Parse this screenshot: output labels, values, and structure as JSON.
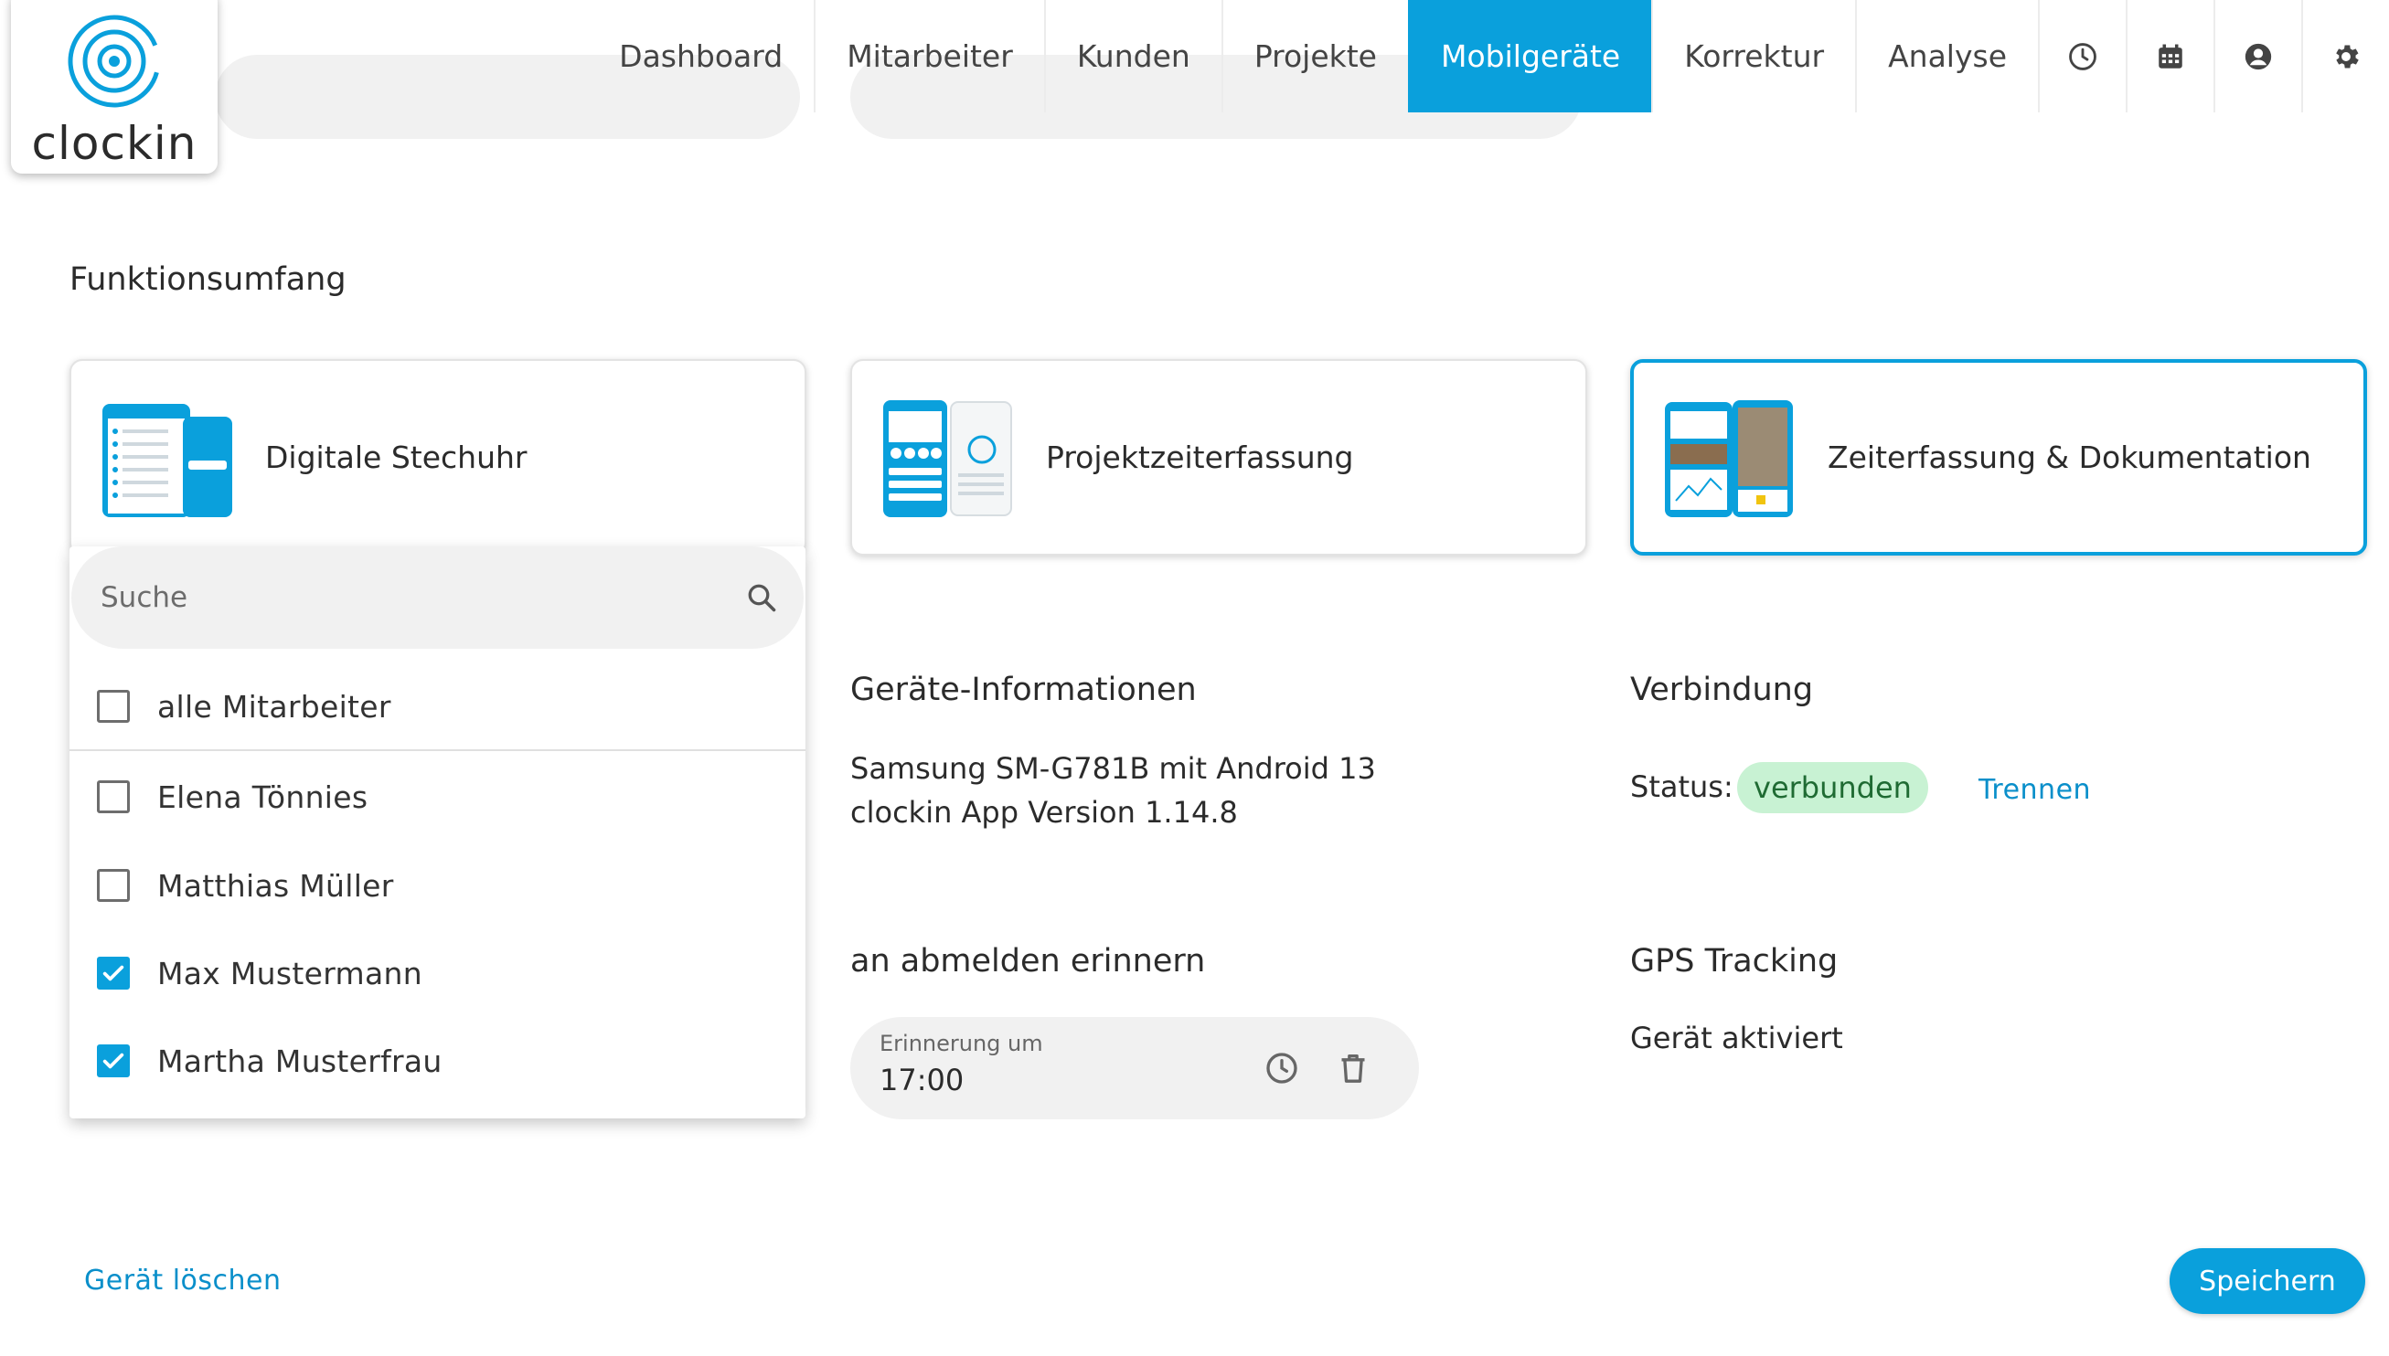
{
  "brand": {
    "name": "clockin",
    "accent": "#0aa0dc"
  },
  "nav": {
    "items": [
      {
        "label": "Dashboard",
        "active": false
      },
      {
        "label": "Mitarbeiter",
        "active": false
      },
      {
        "label": "Kunden",
        "active": false
      },
      {
        "label": "Projekte",
        "active": false
      },
      {
        "label": "Mobilgeräte",
        "active": true
      },
      {
        "label": "Korrektur",
        "active": false
      },
      {
        "label": "Analyse",
        "active": false
      }
    ],
    "icons": [
      "clock-icon",
      "calendar-icon",
      "account-icon",
      "gear-icon"
    ]
  },
  "features": {
    "title": "Funktionsumfang",
    "cards": [
      {
        "label": "Digitale Stechuhr",
        "selected": false
      },
      {
        "label": "Projektzeiterfassung",
        "selected": false
      },
      {
        "label": "Zeiterfassung & Dokumentation",
        "selected": true
      }
    ]
  },
  "employee_dropdown": {
    "search_placeholder": "Suche",
    "items": [
      {
        "label": "alle Mitarbeiter",
        "checked": false
      },
      {
        "label": "Elena Tönnies",
        "checked": false
      },
      {
        "label": "Matthias Müller",
        "checked": false
      },
      {
        "label": "Max Mustermann",
        "checked": true
      },
      {
        "label": "Martha Musterfrau",
        "checked": true
      }
    ]
  },
  "device_info": {
    "title": "Geräte-Informationen",
    "line1": "Samsung SM-G781B mit Android 13",
    "line2": "clockin App Version 1.14.8"
  },
  "connection": {
    "title": "Verbindung",
    "status_label": "Status:",
    "status_value": "verbunden",
    "disconnect_label": "Trennen",
    "status_color": "#c8f2d3"
  },
  "logout_reminder": {
    "title": "an abmelden erinnern",
    "field_label": "Erinnerung um",
    "field_value": "17:00"
  },
  "gps": {
    "title": "GPS Tracking",
    "value": "Gerät aktiviert"
  },
  "footer": {
    "delete_label": "Gerät löschen",
    "save_label": "Speichern"
  }
}
